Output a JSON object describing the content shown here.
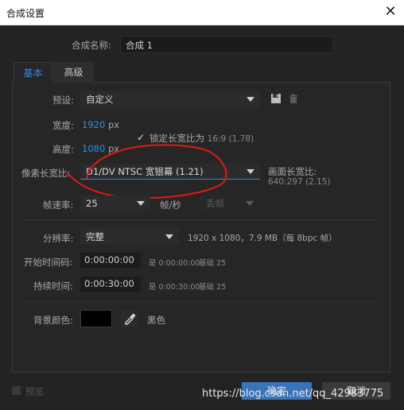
{
  "window": {
    "title": "合成设置",
    "close_icon": "✕"
  },
  "comp_name": {
    "label": "合成名称:",
    "value": "合成 1"
  },
  "tabs": [
    {
      "label": "基本"
    },
    {
      "label": "高级"
    }
  ],
  "preset": {
    "label": "预设:",
    "value": "自定义",
    "save_icon": "save-icon",
    "delete_icon": "trash-icon"
  },
  "width": {
    "label": "宽度:",
    "value": "1920",
    "unit": "px"
  },
  "height": {
    "label": "高度:",
    "value": "1080",
    "unit": "px"
  },
  "lock_aspect": {
    "checked": true,
    "label": "锁定长宽比为",
    "ratio": "16:9 (1.78)"
  },
  "pixel_aspect": {
    "label": "像素长宽比:",
    "value": "D1/DV NTSC 宽银幕 (1.21)"
  },
  "frame_aspect": {
    "label": "画面长宽比:",
    "value": "640:297 (2.15)"
  },
  "frame_rate": {
    "label": "帧速率:",
    "value": "25",
    "unit": "帧/秒",
    "drop_frame": "丢帧"
  },
  "resolution": {
    "label": "分辨率:",
    "value": "完整",
    "info": "1920 x 1080，7.9 MB（每 8bpc 帧）"
  },
  "start_timecode": {
    "label": "开始时间码:",
    "value": "0:00:00:00",
    "equals": "是 0:00:00:00",
    "base": "基础 25"
  },
  "duration": {
    "label": "持续时间:",
    "value": "0:00:30:00",
    "equals": "是 0:00:30:00",
    "base": "基础 25"
  },
  "background": {
    "label": "背景颜色:",
    "color_name": "黑色",
    "color": "#000000"
  },
  "footer": {
    "preview_label": "预览",
    "ok_label": "确定",
    "cancel_label": "取消"
  },
  "watermark": "https://blog.csdn.net/qq_42983775"
}
